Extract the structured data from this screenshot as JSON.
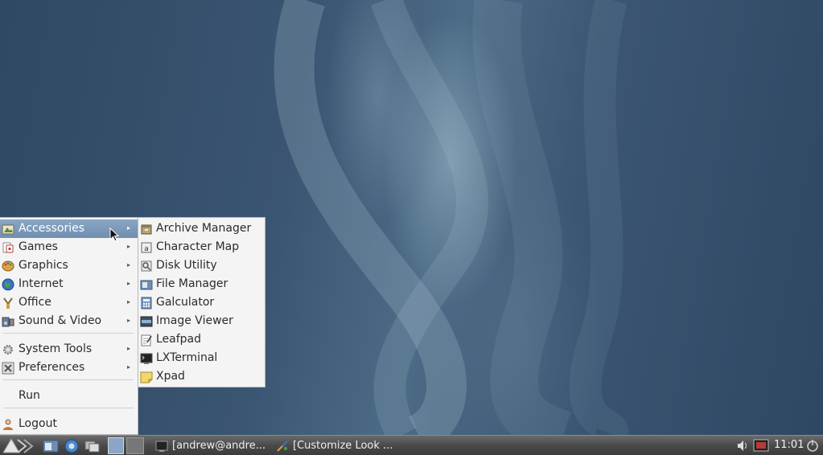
{
  "main_menu": {
    "items": [
      {
        "label": "Accessories",
        "icon": "accessories-icon",
        "submenu": true
      },
      {
        "label": "Games",
        "icon": "games-icon",
        "submenu": true
      },
      {
        "label": "Graphics",
        "icon": "graphics-icon",
        "submenu": true
      },
      {
        "label": "Internet",
        "icon": "internet-icon",
        "submenu": true
      },
      {
        "label": "Office",
        "icon": "office-icon",
        "submenu": true
      },
      {
        "label": "Sound & Video",
        "icon": "sound-video-icon",
        "submenu": true
      },
      {
        "label": "System Tools",
        "icon": "system-tools-icon",
        "submenu": true
      },
      {
        "label": "Preferences",
        "icon": "preferences-icon",
        "submenu": true
      },
      {
        "label": "Run",
        "icon": "",
        "submenu": false
      },
      {
        "label": "Logout",
        "icon": "logout-icon",
        "submenu": false
      }
    ],
    "active_item": "Accessories",
    "submenu_arrow": "▸"
  },
  "sub_menu": {
    "items": [
      {
        "label": "Archive Manager",
        "icon": "archive-manager-icon"
      },
      {
        "label": "Character Map",
        "icon": "character-map-icon"
      },
      {
        "label": "Disk Utility",
        "icon": "disk-utility-icon"
      },
      {
        "label": "File Manager",
        "icon": "file-manager-icon"
      },
      {
        "label": "Galculator",
        "icon": "calculator-icon"
      },
      {
        "label": "Image Viewer",
        "icon": "image-viewer-icon"
      },
      {
        "label": "Leafpad",
        "icon": "leafpad-icon"
      },
      {
        "label": "LXTerminal",
        "icon": "terminal-icon"
      },
      {
        "label": "Xpad",
        "icon": "xpad-icon"
      }
    ]
  },
  "taskbar": {
    "tasks": [
      {
        "label": "[andrew@andre...",
        "icon": "terminal-icon"
      },
      {
        "label": "[Customize Look ...",
        "icon": "customize-icon"
      }
    ],
    "clock": "11:01"
  },
  "colors": {
    "menu_bg": "#f4f4f4",
    "highlight": "#7b98b9",
    "taskbar": "#4a4a4a",
    "desktop": "#3b5470"
  }
}
